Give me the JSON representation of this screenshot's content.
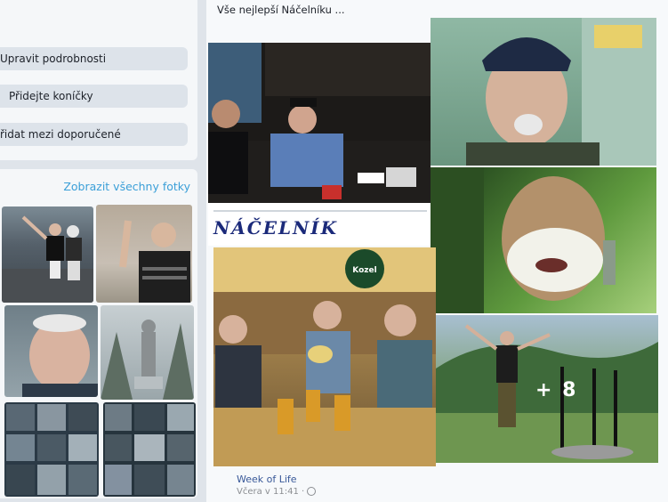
{
  "profile_actions": {
    "edit_details": "Upravit podrobnosti",
    "add_hobbies": "Přidejte koníčky",
    "add_featured": "řidat mezi doporučené"
  },
  "photos": {
    "show_all_label": "Zobrazit všechny fotky"
  },
  "post": {
    "title": "Vše nejlepší Náčelníku ...",
    "handwritten_caption": "NÁČELNÍK WOLAKŮ",
    "beer_logo": "Kozel",
    "more_count": "+ 8",
    "author": "Week of Life",
    "time": "Včera v 11:41 ·"
  },
  "colors": {
    "link": "#3b9fd8",
    "pill_bg": "#dde3ea",
    "card_bg": "#f5f7f9"
  }
}
